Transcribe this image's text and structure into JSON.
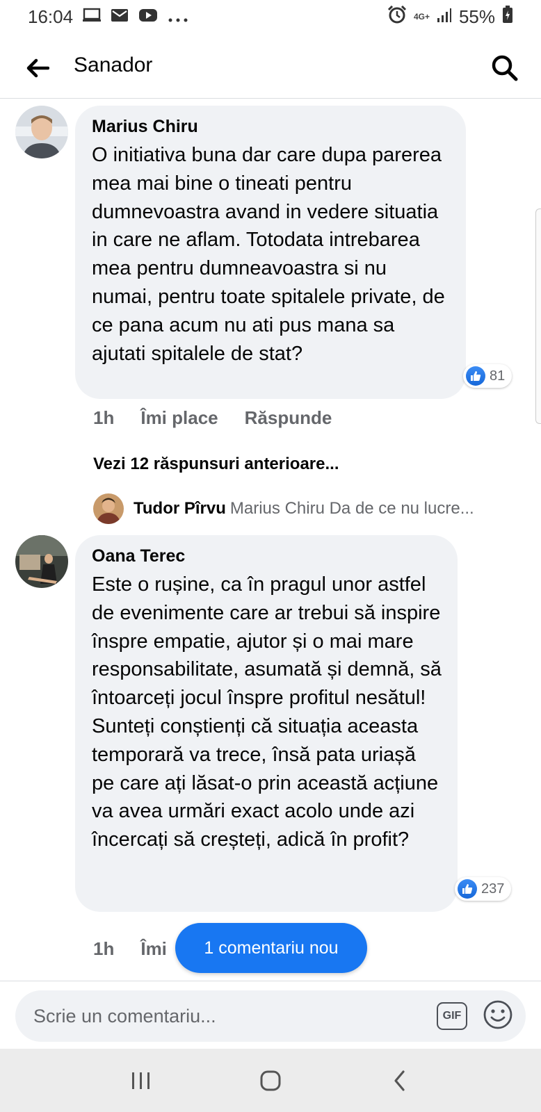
{
  "status_bar": {
    "time": "16:04",
    "network": "4G+",
    "battery": "55%"
  },
  "header": {
    "title": "Sanador"
  },
  "comments": [
    {
      "author": "Marius Chiru",
      "text": "O initiativa buna dar care dupa parerea mea mai bine o tineati pentru dumnevoastra avand in vedere situatia in care ne aflam. Totodata intrebarea mea pentru dumneavoastra si nu numai, pentru toate spitalele private, de ce pana acum nu ati pus mana sa ajutati spitalele de stat?",
      "reactions": "81",
      "time": "1h",
      "like_label": "Îmi place",
      "reply_label": "Răspunde",
      "more_replies": "Vezi 12 răspunsuri anterioare...",
      "reply_preview": {
        "author": "Tudor Pîrvu",
        "text": "Marius Chiru Da de ce nu lucre..."
      }
    },
    {
      "author": "Oana Terec",
      "text": "Este o rușine, ca în pragul unor astfel de evenimente care ar trebui să inspire înspre empatie, ajutor și o mai mare responsabilitate, asumată și demnă, să întoarceți jocul înspre profitul nesătul! Sunteți conștienți că situația aceasta temporară va trece, însă pata uriașă pe care ați lăsat-o prin această acțiune va avea urmări exact acolo unde azi încercați să creșteți, adică în profit?",
      "reactions": "237",
      "time": "1h",
      "like_label": "Îmi"
    }
  ],
  "new_comments_pill": "1 comentariu nou",
  "composer": {
    "placeholder": "Scrie un comentariu...",
    "gif_label": "GIF"
  },
  "colors": {
    "accent": "#1877f2",
    "bubble": "#f0f2f5",
    "secondary_text": "#65676b"
  }
}
